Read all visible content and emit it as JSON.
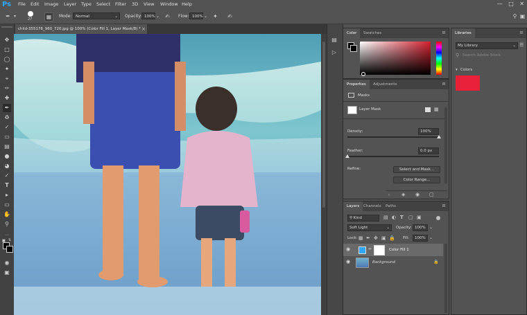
{
  "app": {
    "logo": "Ps"
  },
  "menu": [
    "File",
    "Edit",
    "Image",
    "Layer",
    "Type",
    "Select",
    "Filter",
    "3D",
    "View",
    "Window",
    "Help"
  ],
  "options_bar": {
    "brush_size": "27",
    "mode_label": "Mode:",
    "mode_value": "Normal",
    "opacity_label": "Opacity:",
    "opacity_value": "100%",
    "flow_label": "Flow:",
    "flow_value": "100%"
  },
  "document": {
    "tab_title": "child-355176_960_720.jpg @ 100% (Color Fill 1, Layer Mask/8) *",
    "close": "×"
  },
  "color_panel": {
    "tabs": [
      "Color",
      "Swatches"
    ],
    "hue_color": "#d4202f"
  },
  "properties_panel": {
    "tabs": [
      "Properties",
      "Adjustments"
    ],
    "section_title": "Masks",
    "mask_label": "Layer Mask",
    "density_label": "Density:",
    "density_value": "100%",
    "density_fraction": 1.0,
    "feather_label": "Feather:",
    "feather_value": "0.0 px",
    "feather_fraction": 0.0,
    "refine_label": "Refine:",
    "select_mask_button": "Select and Mask...",
    "color_range_button": "Color Range..."
  },
  "layers_panel": {
    "tabs": [
      "Layers",
      "Channels",
      "Paths"
    ],
    "filter_kind": "Kind",
    "blend_mode": "Soft Light",
    "opacity_label": "Opacity:",
    "opacity_value": "100%",
    "lock_label": "Lock:",
    "fill_label": "Fill:",
    "fill_value": "100%",
    "layers": [
      {
        "name": "Color Fill 1",
        "visible": true,
        "selected": true
      },
      {
        "name": "Background",
        "visible": true,
        "locked": true
      }
    ]
  },
  "libraries_panel": {
    "tab": "Libraries",
    "library_select": "My Library",
    "search_placeholder": "Search Adobe Stock",
    "colors_section": "Colors",
    "swatch_color": "#e8203a"
  },
  "colors": {
    "accent": "#31a8ff"
  }
}
